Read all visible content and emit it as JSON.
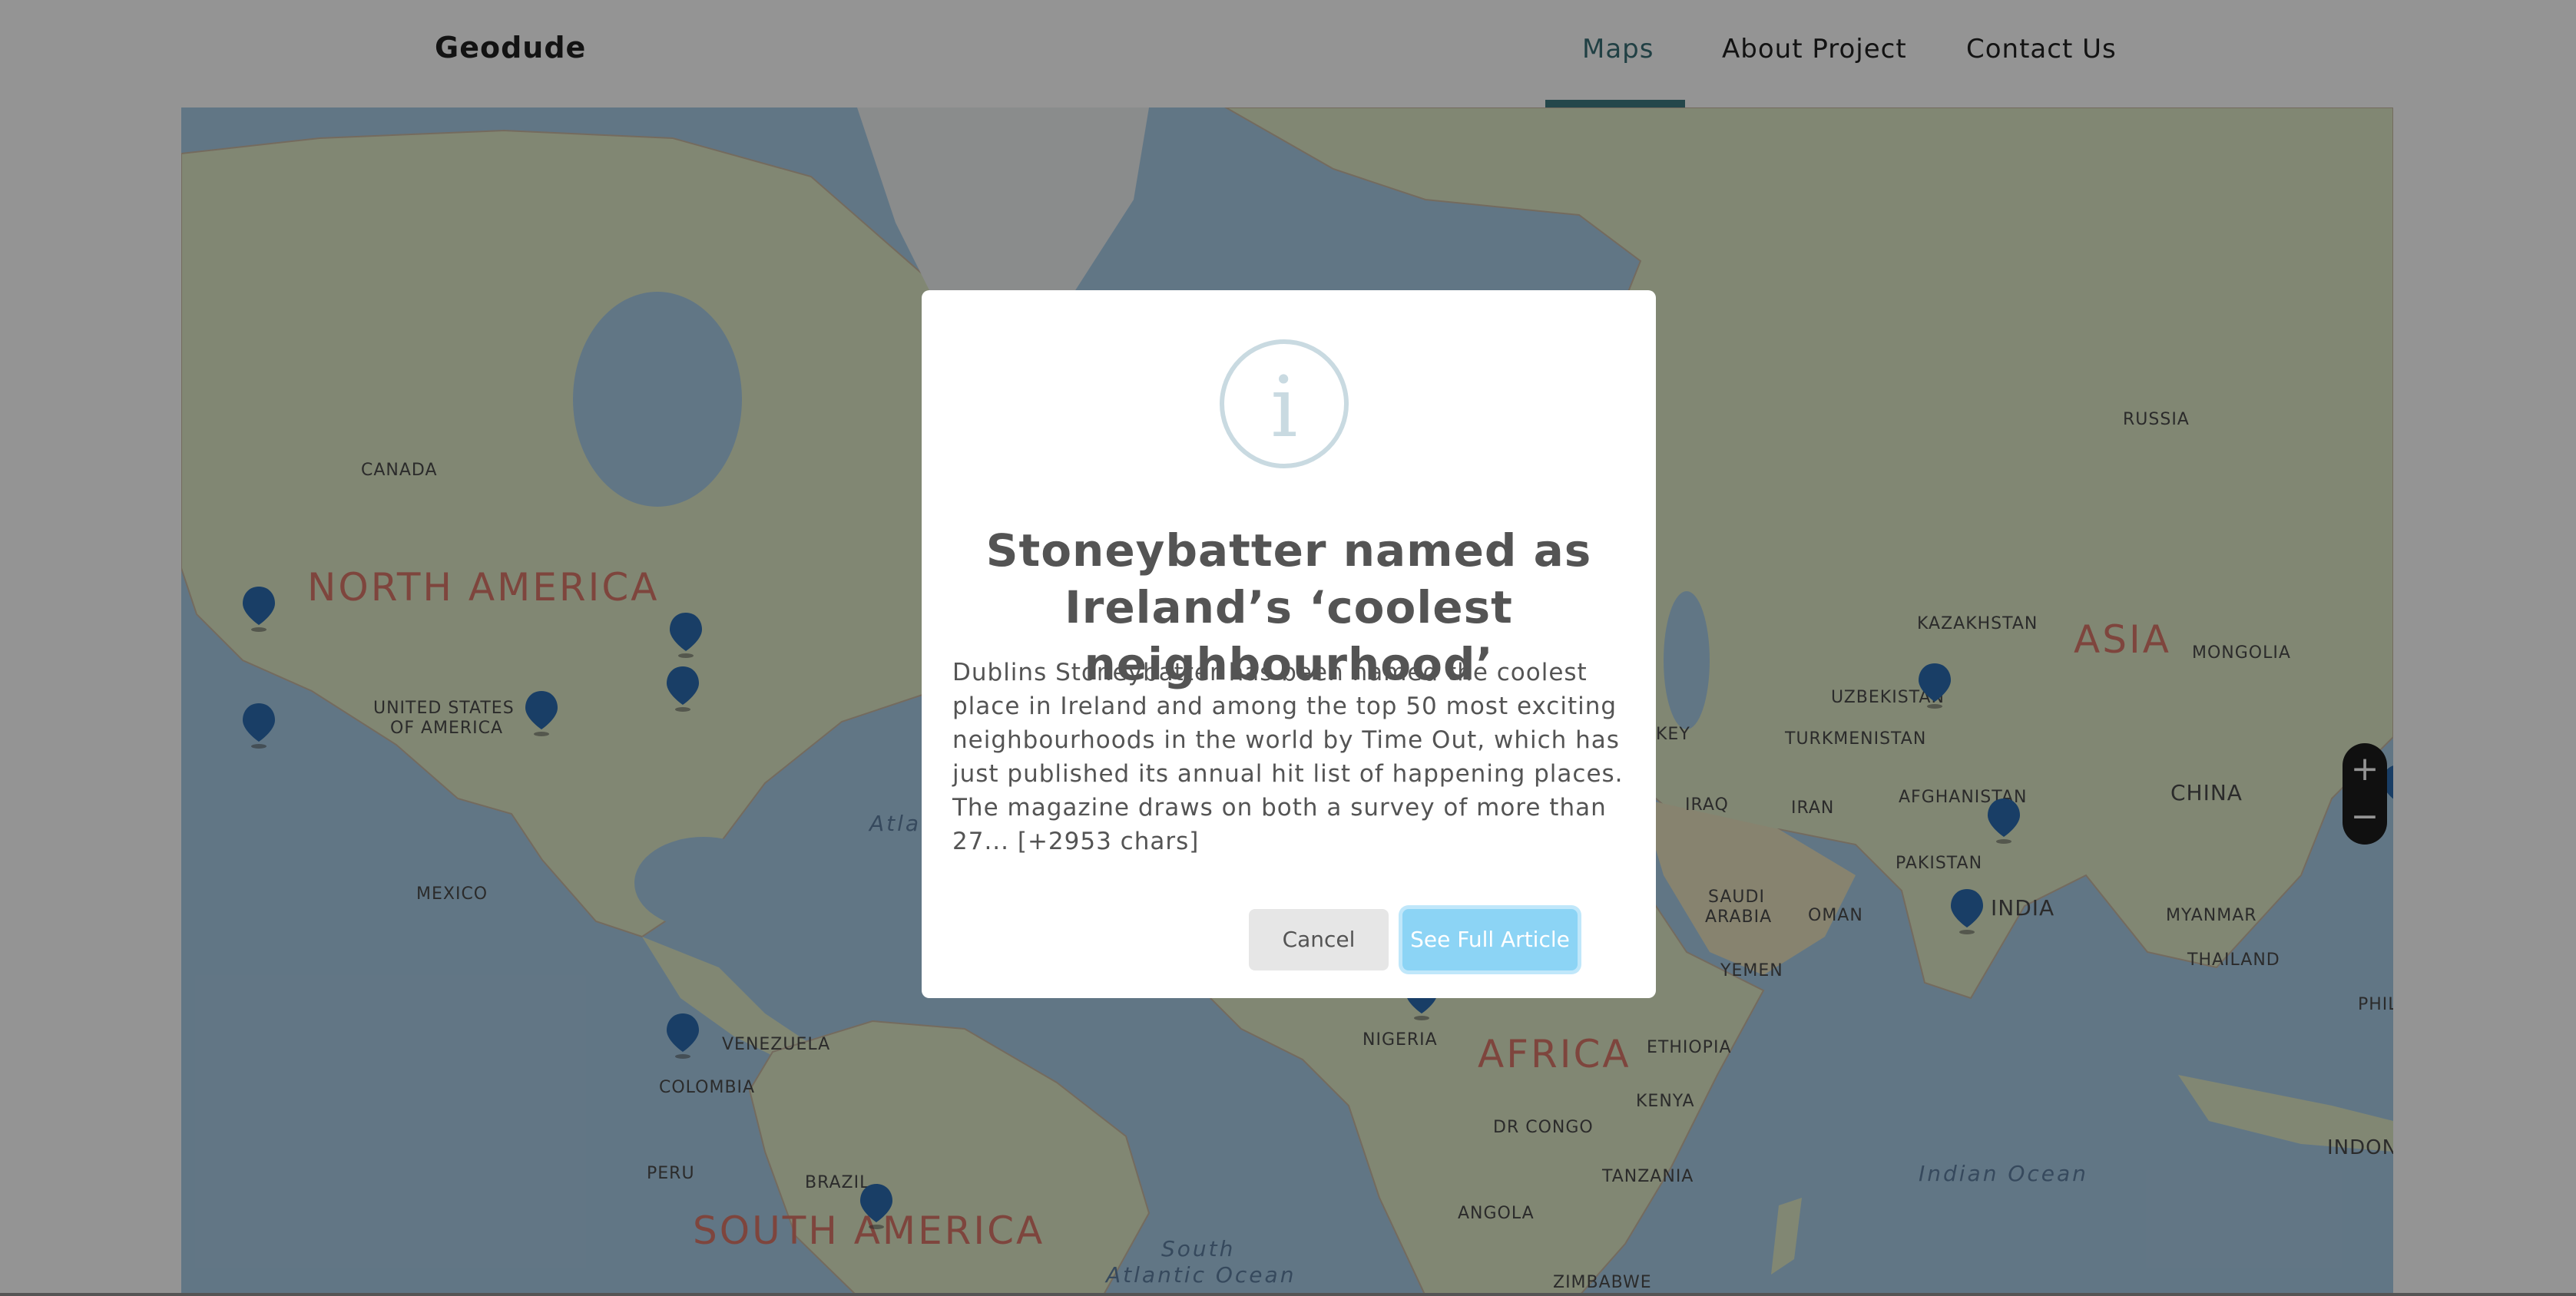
{
  "header": {
    "brand": "Geodude",
    "nav": [
      {
        "label": "Maps",
        "active": true
      },
      {
        "label": "About Project",
        "active": false
      },
      {
        "label": "Contact Us",
        "active": false
      }
    ]
  },
  "map": {
    "country_labels": [
      "CANADA",
      "UNITED STATES",
      "OF AMERICA",
      "MEXICO",
      "VENEZUELA",
      "COLOMBIA",
      "PERU",
      "BRAZIL",
      "RUSSIA",
      "KAZAKHSTAN",
      "MONGOLIA",
      "UZBEKISTAN",
      "TURKMENISTAN",
      "AFGHANISTAN",
      "IRAN",
      "IRAQ",
      "PAKISTAN",
      "INDIA",
      "CHINA",
      "MYANMAR",
      "THAILAND",
      "SAUDI",
      "ARABIA",
      "OMAN",
      "YEMEN",
      "ETHIOPIA",
      "KENYA",
      "NIGERIA",
      "DR CONGO",
      "TANZANIA",
      "ANGOLA",
      "ZIMBABWE",
      "INDONESI",
      "PHIL",
      "KEY"
    ],
    "continents": [
      "NORTH AMERICA",
      "SOUTH AMERICA",
      "AFRICA",
      "ASIA"
    ],
    "oceans": [
      "Atla",
      "South",
      "Atlantic Ocean",
      "Indian Ocean"
    ],
    "zoom_in": "+",
    "zoom_out": "−",
    "pin_count": 12
  },
  "modal": {
    "icon": "info-icon",
    "icon_glyph": "i",
    "title": "Stoneybatter named as Ireland’s ‘coolest neighbourhood’",
    "body": "Dublins Stoneybatter has been named the coolest place in Ireland and among the top 50 most exciting neighbourhoods in the world by Time Out, which has just published its annual hit list of happening places. The magazine draws on both a survey of more than 27... [+2953 chars]",
    "cancel_label": "Cancel",
    "confirm_label": "See Full Article"
  },
  "colors": {
    "accent": "#3f7a82",
    "pin": "#2b6cb0",
    "confirm_button": "#8cd4f5",
    "continent_label": "#d9786a"
  }
}
